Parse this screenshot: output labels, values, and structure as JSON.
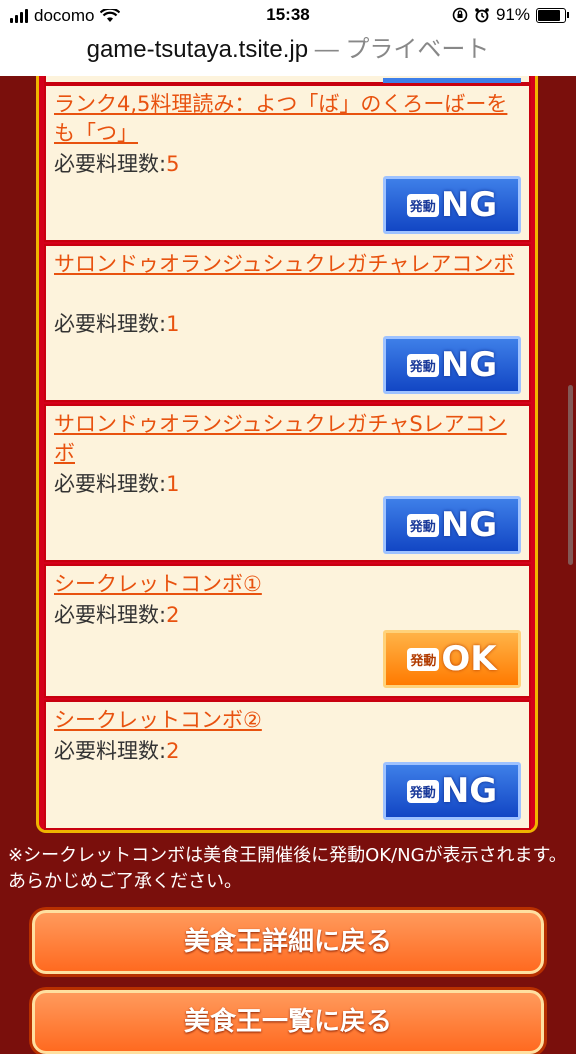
{
  "status_bar": {
    "carrier": "docomo",
    "time": "15:38",
    "battery": "91%",
    "battery_level": 0.91
  },
  "url_bar": {
    "domain": "game-tsutaya.tsite.jp",
    "suffix": " — プライベート"
  },
  "combos": [
    {
      "title": "ランク4,5料理読み：よつ「ば」のくろーばーをも「つ」",
      "req_label": "必要料理数:",
      "req_value": "5",
      "badge_label": "発動",
      "badge_value": "NG",
      "status": "ng"
    },
    {
      "title": "サロンドゥオランジュシュクレガチャレアコンボ",
      "req_label": "必要料理数:",
      "req_value": "1",
      "badge_label": "発動",
      "badge_value": "NG",
      "status": "ng"
    },
    {
      "title": "サロンドゥオランジュシュクレガチャSレアコンボ",
      "req_label": "必要料理数:",
      "req_value": "1",
      "badge_label": "発動",
      "badge_value": "NG",
      "status": "ng"
    },
    {
      "title": "シークレットコンボ①",
      "req_label": "必要料理数:",
      "req_value": "2",
      "badge_label": "発動",
      "badge_value": "OK",
      "status": "ok"
    },
    {
      "title": "シークレットコンボ②",
      "req_label": "必要料理数:",
      "req_value": "2",
      "badge_label": "発動",
      "badge_value": "NG",
      "status": "ng"
    }
  ],
  "note": "※シークレットコンボは美食王開催後に発動OK/NGが表示されます。あらかじめご了承ください。",
  "buttons": {
    "back_detail": "美食王詳細に戻る",
    "back_list": "美食王一覧に戻る"
  },
  "colors": {
    "background": "#7a0f0c",
    "card": "#fdf3dc",
    "title": "#e8520f",
    "ng_badge": "#1246c4",
    "ok_badge": "#ff7a00"
  }
}
